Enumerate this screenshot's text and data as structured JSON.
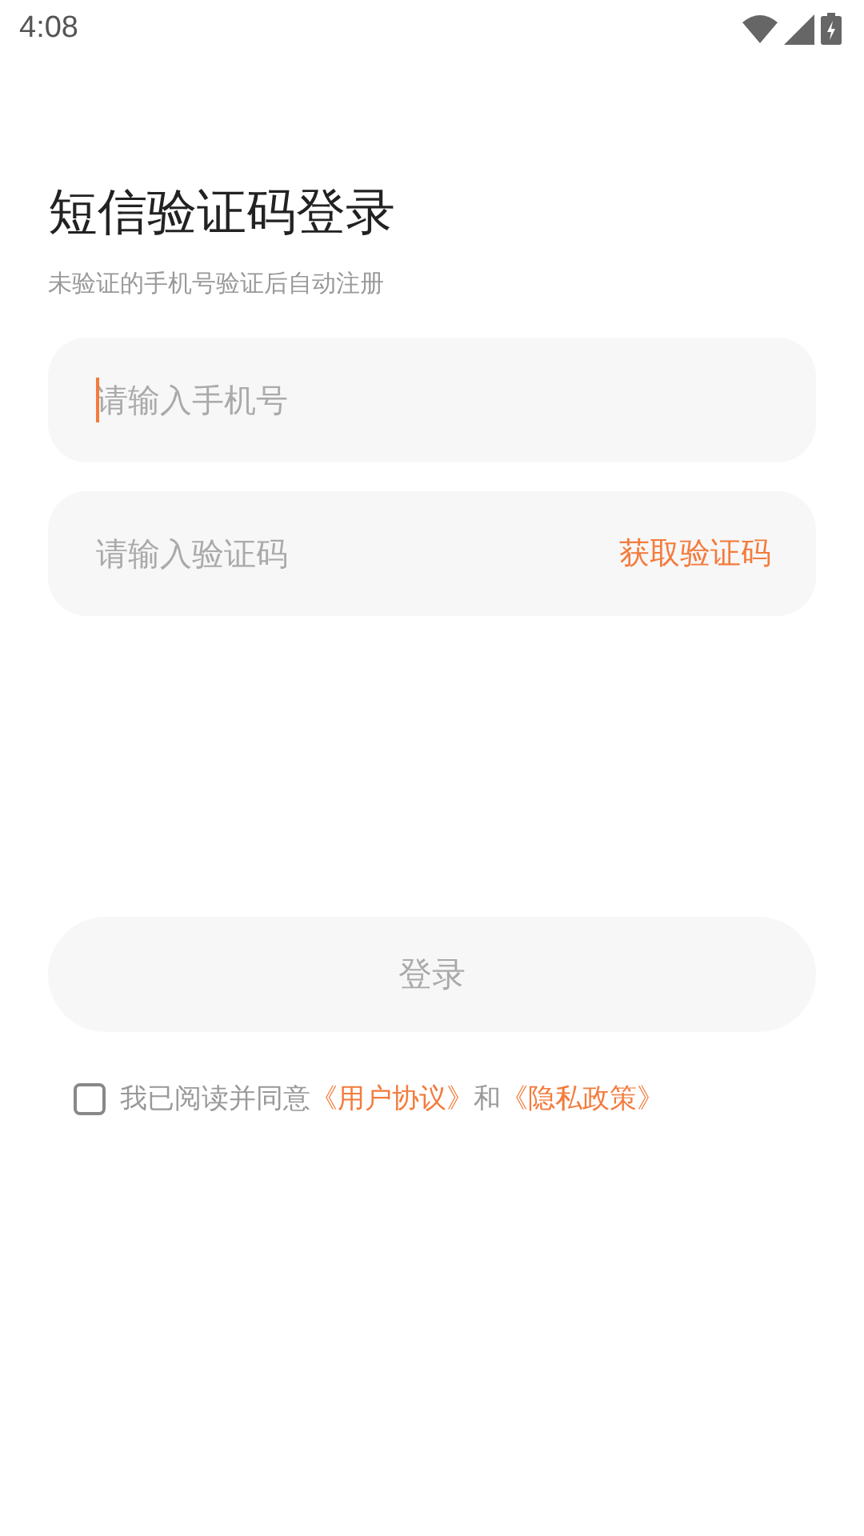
{
  "status_bar": {
    "time": "4:08"
  },
  "title": "短信验证码登录",
  "subtitle": "未验证的手机号验证后自动注册",
  "phone_field": {
    "placeholder": "请输入手机号",
    "focused": true
  },
  "code_field": {
    "placeholder": "请输入验证码",
    "action": "获取验证码"
  },
  "login_button": {
    "label": "登录",
    "disabled": true
  },
  "agreement": {
    "checked": false,
    "parts": [
      {
        "kind": "text",
        "text": "我已阅读并同意"
      },
      {
        "kind": "link",
        "text": "《用户协议》"
      },
      {
        "kind": "text",
        "text": "和"
      },
      {
        "kind": "link",
        "text": "《隐私政策》"
      }
    ]
  }
}
